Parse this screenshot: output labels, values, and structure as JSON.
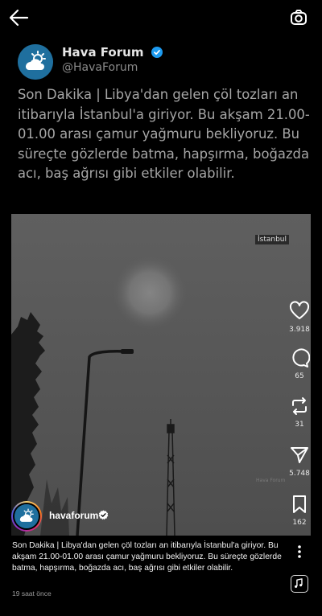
{
  "tweet": {
    "name": "Hava Forum",
    "handle": "@HavaForum",
    "text": "Son Dakika | Libya'dan gelen çöl tozları an itibarıyla İstanbul'a giriyor. Bu akşam 21.00-01.00 arası çamur yağmuru bekliyoruz. Bu süreçte gözlerde batma, hapşırma, boğazda acı, baş ağrısı gibi etkiler olabilir."
  },
  "photo": {
    "location_label": "İstanbul",
    "watermark": "Hava Forum"
  },
  "actions": {
    "likes": "3.918",
    "comments": "65",
    "reposts": "31",
    "shares": "5.748",
    "saves": "162"
  },
  "footer": {
    "username": "havaforum",
    "caption": "Son Dakika | Libya'dan gelen çöl tozları an itibarıyla İstanbul'a giriyor. Bu akşam 21.00-01.00 arası çamur yağmuru bekliyoruz. Bu süreçte gözlerde batma, hapşırma, boğazda acı, baş ağrısı gibi etkiler olabilir.",
    "time": "19 saat önce"
  },
  "colors": {
    "verified": "#1d9bf0",
    "brand_blue": "#1f6f9e",
    "sky_gray": "#5a5a5a"
  }
}
